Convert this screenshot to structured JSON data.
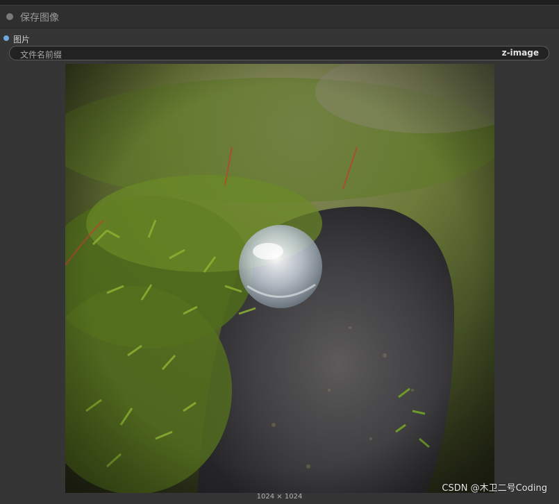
{
  "node": {
    "title": "保存图像",
    "input_label": "图片",
    "widget": {
      "label": "文件名前缀",
      "value": "z-image"
    },
    "image_size": "1024 × 1024"
  },
  "watermark": "CSDN @木卫二号Coding",
  "colors": {
    "node_bg": "#353535",
    "header_bg": "#2f2f2f",
    "input_dot": "#6fa8dc",
    "wire": "#4a90e2"
  },
  "icons": {
    "header": "status-dot-icon",
    "input": "input-slot-icon"
  }
}
